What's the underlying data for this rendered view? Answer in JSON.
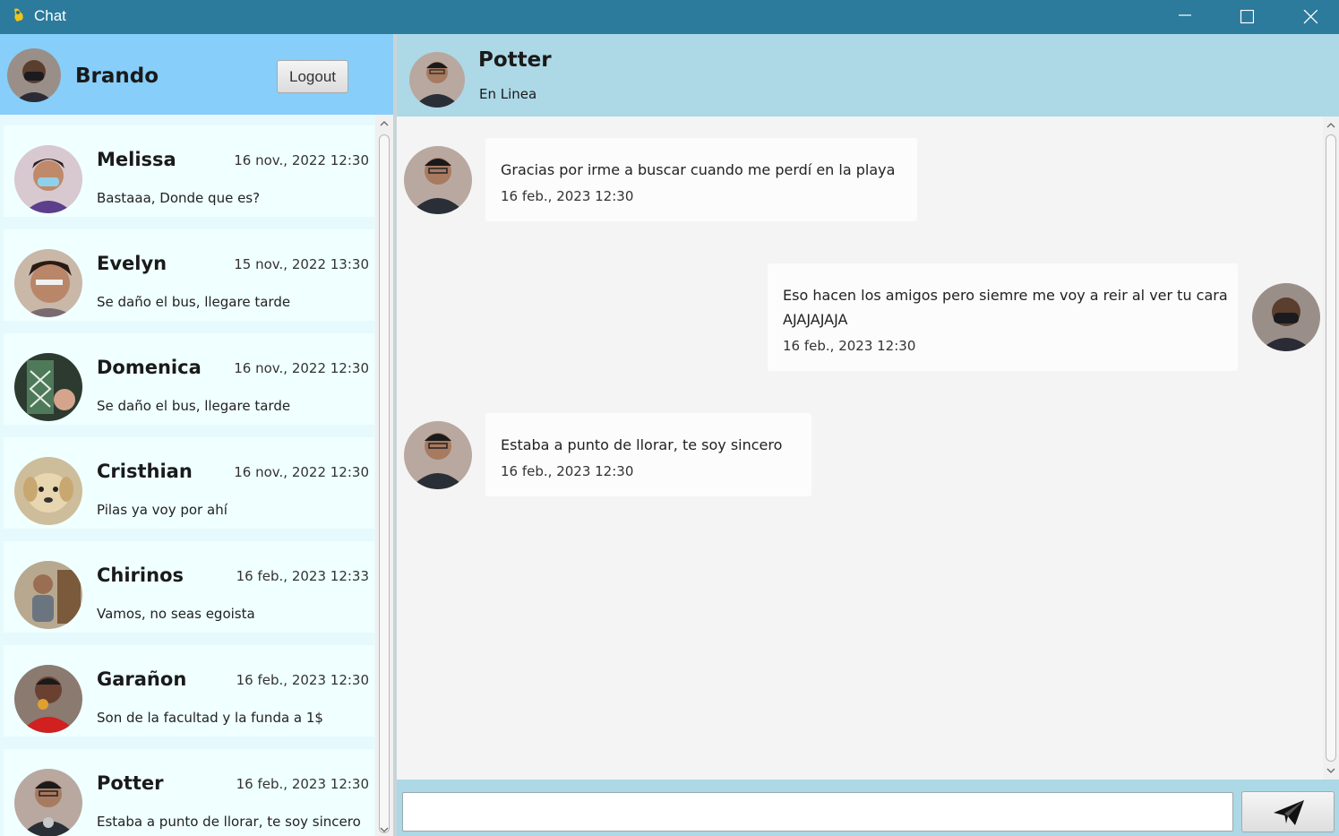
{
  "window": {
    "title": "Chat"
  },
  "user": {
    "name": "Brando",
    "logout_label": "Logout"
  },
  "contacts": [
    {
      "name": "Melissa",
      "time": "16 nov., 2022  12:30",
      "message": "Bastaaa, Donde que es?"
    },
    {
      "name": "Evelyn",
      "time": "15 nov., 2022  13:30",
      "message": "Se daño el bus, llegare tarde"
    },
    {
      "name": "Domenica",
      "time": "16 nov., 2022  12:30",
      "message": "Se daño el bus, llegare tarde"
    },
    {
      "name": "Cristhian",
      "time": "16 nov., 2022  12:30",
      "message": "Pilas ya voy por ahí"
    },
    {
      "name": "Chirinos",
      "time": "16 feb., 2023  12:33",
      "message": "Vamos, no seas egoista"
    },
    {
      "name": "Garañon",
      "time": "16 feb., 2023  12:30",
      "message": "Son de la facultad y la funda a 1$"
    },
    {
      "name": "Potter",
      "time": "16 feb., 2023  12:30",
      "message": "Estaba a punto de llorar, te soy sincero"
    }
  ],
  "chat": {
    "contact_name": "Potter",
    "status": "En Linea",
    "messages": [
      {
        "text": "Gracias por irme a buscar cuando me perdí en la playa",
        "time": "16 feb., 2023  12:30",
        "direction": "incoming"
      },
      {
        "text": "Eso hacen los amigos pero siemre me voy a reir al ver tu cara AJAJAJAJA",
        "time": "16 feb., 2023  12:30",
        "direction": "outgoing"
      },
      {
        "text": "Estaba a punto de llorar, te soy sincero",
        "time": "16 feb., 2023  12:30",
        "direction": "incoming"
      }
    ],
    "input_value": ""
  },
  "icons": {
    "app": "chat-app-icon",
    "minimize": "minimize-icon",
    "maximize": "maximize-icon",
    "close": "close-icon",
    "send": "paper-plane-icon"
  },
  "colors": {
    "title_bar": "#2c7a9c",
    "left_header": "#87cefa",
    "chat_header": "#add8e6",
    "contact_bg": "#f0ffff",
    "messages_bg": "#f4f4f4"
  }
}
